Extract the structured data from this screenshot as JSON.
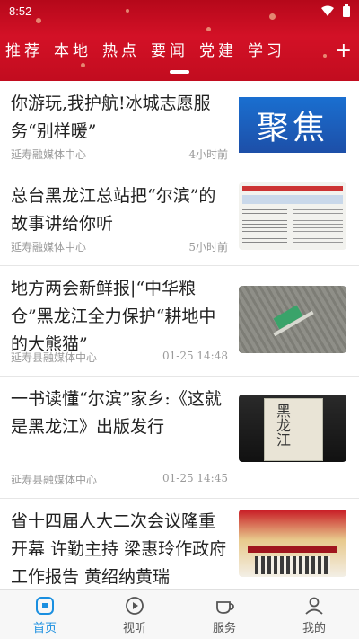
{
  "status": {
    "time": "8:52"
  },
  "tabs": [
    "推荐",
    "本地",
    "热点",
    "要闻",
    "党建",
    "学习"
  ],
  "add_label": "+",
  "articles": [
    {
      "title": "你游玩,我护航!冰城志愿服务“别样暖”",
      "source": "延寿融媒体中心",
      "time": "4小时前",
      "thumb_text": "聚焦"
    },
    {
      "title": "总台黑龙江总站把“尔滨”的故事讲给你听",
      "source": "延寿融媒体中心",
      "time": "5小时前",
      "thumb_text": ""
    },
    {
      "title": "地方两会新鲜报|“中华粮仓”黑龙江全力保护“耕地中的大熊猫”",
      "source": "延寿县融媒体中心",
      "time": "01-25 14:48",
      "thumb_text": ""
    },
    {
      "title": "一书读懂“尔滨”家乡:《这就是黑龙江》出版发行",
      "source": "延寿县融媒体中心",
      "time": "01-25 14:45",
      "thumb_text": "黑龙江"
    },
    {
      "title": "省十四届人大二次会议隆重开幕 许勤主持 梁惠玲作政府工作报告 黄绍纳黄瑞",
      "source": "",
      "time": "",
      "thumb_text": ""
    }
  ],
  "nav": [
    "首页",
    "视听",
    "服务",
    "我的"
  ],
  "colors": {
    "header": "#c70e22",
    "accent": "#1a8fe0"
  }
}
